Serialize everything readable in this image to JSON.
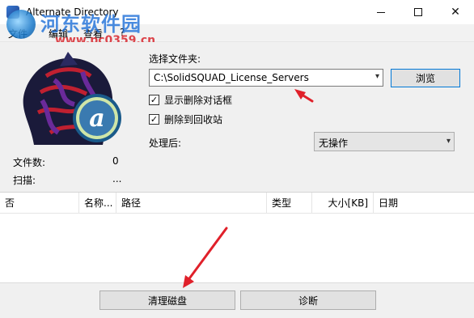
{
  "window": {
    "title": "Alternate Directory",
    "minimize_icon": "minimize-icon",
    "maximize_icon": "maximize-icon",
    "close_icon": "close-icon"
  },
  "watermark": {
    "main": "河东软件园",
    "url": "www.pc0359.cn"
  },
  "menu": {
    "items": [
      "文件",
      "编辑",
      "查看",
      "?"
    ]
  },
  "stats": {
    "file_count_label": "文件数:",
    "file_count_value": "0",
    "scan_label": "扫描:",
    "scan_value": "..."
  },
  "folder": {
    "label": "选择文件夹:",
    "path": "C:\\SolidSQUAD_License_Servers",
    "browse_label": "浏览"
  },
  "options": {
    "show_delete_dialog": {
      "label": "显示删除对话框",
      "checked": true
    },
    "delete_to_recycle": {
      "label": "删除到回收站",
      "checked": true
    }
  },
  "after_process": {
    "label": "处理后:",
    "value": "无操作"
  },
  "list": {
    "columns": [
      "否",
      "名称...",
      "路径",
      "类型",
      "大小[KB]",
      "日期"
    ]
  },
  "buttons": {
    "clean_disk": "清理磁盘",
    "diagnose": "诊断"
  },
  "colors": {
    "accent": "#0078d7",
    "annotation_arrow": "#e0202a"
  }
}
